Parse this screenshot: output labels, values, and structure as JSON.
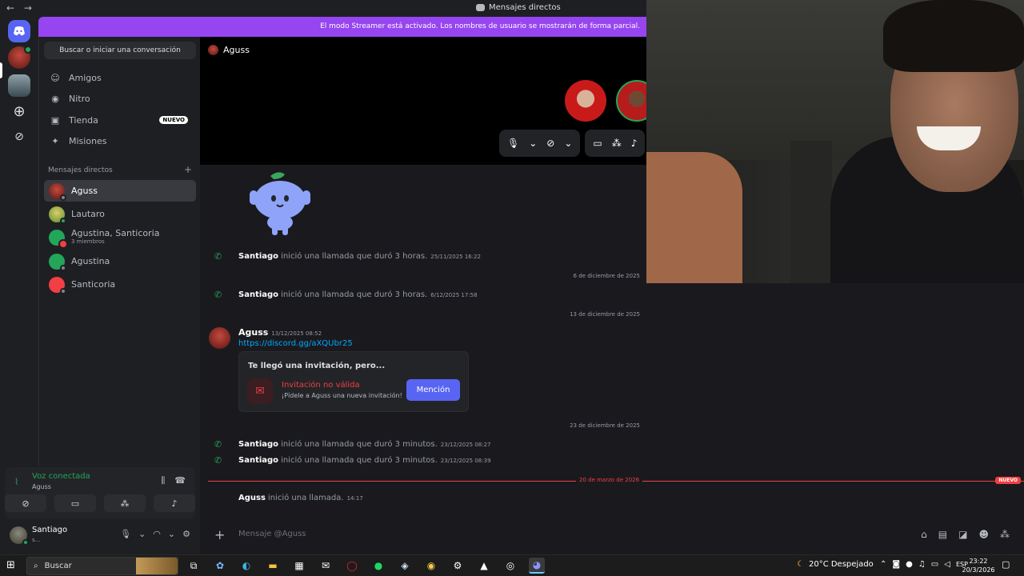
{
  "titlebar": {
    "back": "←",
    "forward": "→",
    "title": "Mensajes directos"
  },
  "banner": {
    "text": "El modo Streamer está activado. Los nombres de usuario se mostrarán de forma parcial."
  },
  "sidebar": {
    "search_label": "Buscar o iniciar una conversación",
    "nav": [
      {
        "label": "Amigos",
        "icon": "friends-icon"
      },
      {
        "label": "Nitro",
        "icon": "nitro-icon"
      },
      {
        "label": "Tienda",
        "icon": "shop-icon",
        "badge": "NUEVO"
      },
      {
        "label": "Misiones",
        "icon": "quests-icon"
      }
    ],
    "dm_header": "Mensajes directos",
    "dm_add": "+",
    "dms": [
      {
        "name": "Aguss",
        "sub": "",
        "color": "#8b1c1c",
        "online": false
      },
      {
        "name": "Lautaro",
        "sub": "",
        "color": "#7cae4a",
        "online": true
      },
      {
        "name": "Agustina, Santicoria",
        "sub": "3 miembros",
        "color": "#23a55a",
        "online": false
      },
      {
        "name": "Agustina",
        "sub": "",
        "color": "#23a55a",
        "online": false
      },
      {
        "name": "Santicoria",
        "sub": "",
        "color": "#f23f43",
        "online": false
      }
    ]
  },
  "voice": {
    "status": "Voz conectada",
    "channel": "Aguss"
  },
  "user": {
    "name": "Santiago",
    "status": "s..."
  },
  "call": {
    "channel": "Aguss"
  },
  "messages": {
    "call1": {
      "user": "Santiago",
      "text": "inició una llamada que duró 3 horas.",
      "time": "25/11/2025 16:22"
    },
    "div1": "6 de diciembre de 2025",
    "call2": {
      "user": "Santiago",
      "text": "inició una llamada que duró 3 horas.",
      "time": "6/12/2025 17:58"
    },
    "div2": "13 de diciembre de 2025",
    "msg": {
      "user": "Aguss",
      "time": "13/12/2025 08:52",
      "link": "https://discord.gg/aXQUbr25"
    },
    "invite": {
      "heading": "Te llegó una invitación, pero...",
      "title": "Invitación no válida",
      "subtitle": "¡Pídele a Aguss una nueva invitación!",
      "button": "Mención"
    },
    "div3": "23 de diciembre de 2025",
    "call3": {
      "user": "Santiago",
      "text": "inició una llamada que duró 3 minutos.",
      "time": "23/12/2025 08:27"
    },
    "call4": {
      "user": "Santiago",
      "text": "inició una llamada que duró 3 minutos.",
      "time": "23/12/2025 08:39"
    },
    "div4": "20 de marzo de 2026",
    "div4_badge": "NUEVO",
    "call5": {
      "user": "Aguss",
      "text": "inició una llamada.",
      "time": "14:17"
    }
  },
  "composer": {
    "placeholder": "Mensaje @Aguss"
  },
  "taskbar": {
    "search": "Buscar",
    "weather": "20°C  Despejado",
    "lang": "ESP",
    "time": "23:22",
    "date": "20/3/2026"
  }
}
